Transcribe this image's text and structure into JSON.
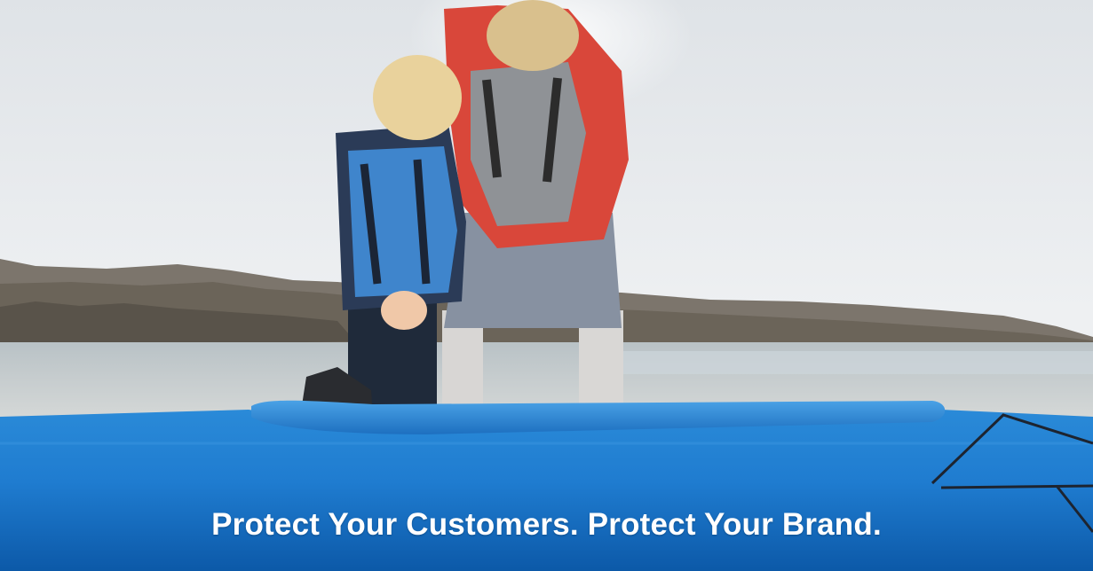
{
  "hero": {
    "headline": "Protect Your Customers.  Protect Your Brand.",
    "scene": [
      "adult",
      "child",
      "life-jacket",
      "kayak",
      "sea",
      "hills",
      "sky"
    ]
  },
  "colors": {
    "sky": "#e9ecef",
    "kayak": "#1f7fd0",
    "kayak_dark": "#0d5fae",
    "jacket_blue": "#3b7fc8",
    "jacket_red": "#d94b3a",
    "headline": "#ffffff"
  }
}
